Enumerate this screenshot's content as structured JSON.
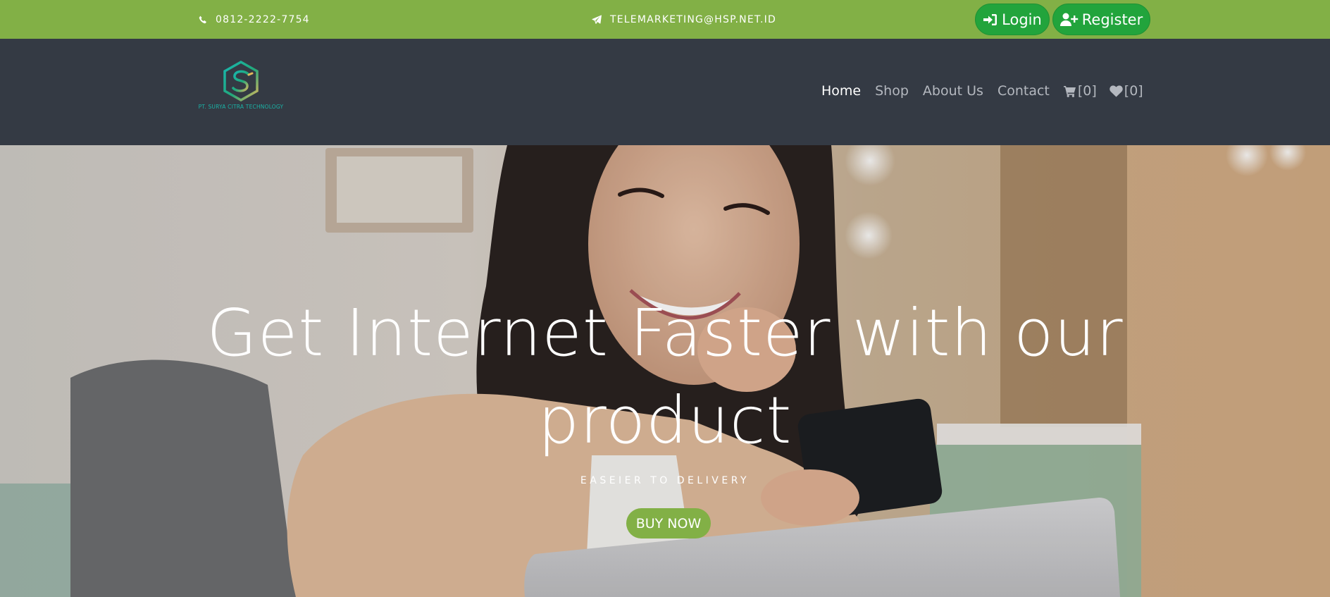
{
  "topbar": {
    "phone": "0812-2222-7754",
    "phone_icon": "phone-icon",
    "email": "TELEMARKETING@HSP.NET.ID",
    "email_icon": "paper-plane-icon",
    "login_label": "Login",
    "login_icon": "sign-in-icon",
    "register_label": "Register",
    "register_icon": "user-plus-icon"
  },
  "brand": {
    "tagline": "PT. SURYA CITRA TECHNOLOGY"
  },
  "nav": {
    "items": [
      {
        "label": "Home",
        "active": true
      },
      {
        "label": "Shop",
        "active": false
      },
      {
        "label": "About Us",
        "active": false
      },
      {
        "label": "Contact",
        "active": false
      }
    ],
    "cart_label": "[0]",
    "cart_icon": "cart-icon",
    "wishlist_label": "[0]",
    "wishlist_icon": "heart-icon"
  },
  "hero": {
    "headline_line1": "Get Internet Faster with our",
    "headline_line2": "product",
    "subheadline": "EASEIER TO DELIVERY",
    "cta_label": "BUY NOW"
  },
  "colors": {
    "topbar_bg": "#82b046",
    "auth_button_bg": "#22a43c",
    "navbar_bg": "#343a44",
    "cta_bg": "#82b046"
  }
}
